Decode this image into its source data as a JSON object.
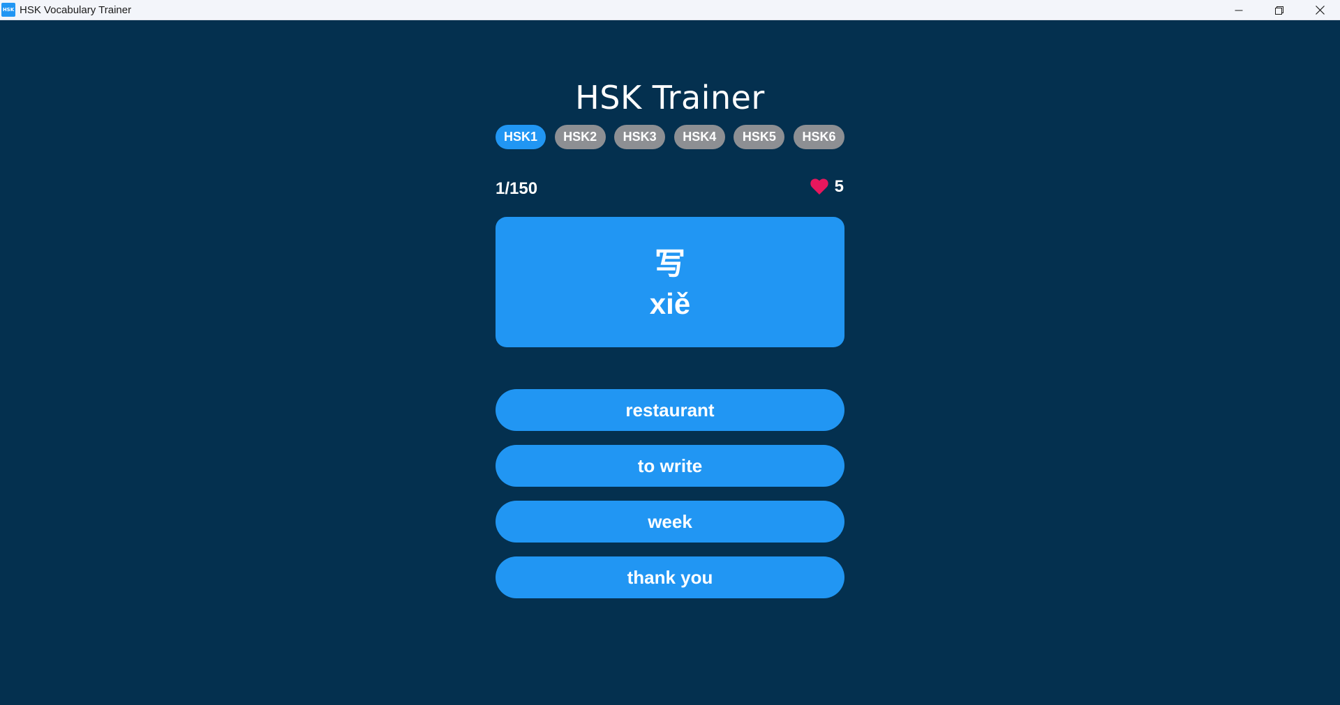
{
  "window": {
    "icon_text": "HSK",
    "title": "HSK Vocabulary Trainer"
  },
  "app": {
    "title": "HSK Trainer",
    "levels": [
      {
        "label": "HSK1",
        "active": true
      },
      {
        "label": "HSK2",
        "active": false
      },
      {
        "label": "HSK3",
        "active": false
      },
      {
        "label": "HSK4",
        "active": false
      },
      {
        "label": "HSK5",
        "active": false
      },
      {
        "label": "HSK6",
        "active": false
      }
    ],
    "progress": "1/150",
    "lives": "5",
    "card": {
      "hanzi": "写",
      "pinyin": "xiě"
    },
    "answers": [
      "restaurant",
      "to write",
      "week",
      "thank you"
    ]
  },
  "colors": {
    "background": "#04304f",
    "accent": "#2196f3",
    "inactive_pill": "#8d8f93",
    "heart": "#e8175d"
  },
  "icons": {
    "lives": "heart-icon",
    "minimize": "minimize-icon",
    "maximize": "restore-icon",
    "close": "close-icon"
  }
}
